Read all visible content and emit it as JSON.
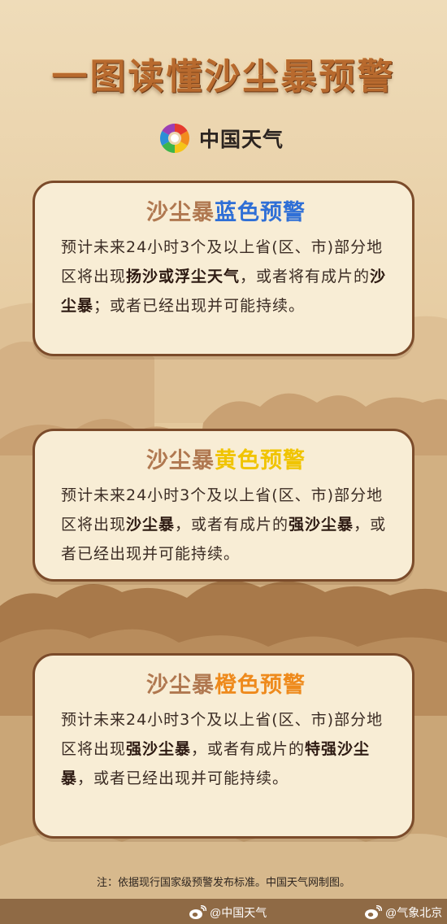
{
  "title": "一图读懂沙尘暴预警",
  "brand": {
    "name": "中国天气",
    "logo_icon": "china-weather-logo-icon"
  },
  "watermark_text": "中国天气",
  "cards": [
    {
      "title_prefix": "沙尘暴",
      "title_level": "蓝色预警",
      "level_color": "#2f6fd6",
      "segments": [
        {
          "text": "预计未来24小时3个及以上省(区、市)部分地区将出现",
          "bold": false
        },
        {
          "text": "扬沙或浮尘天气",
          "bold": true
        },
        {
          "text": "，或者将有成片的",
          "bold": false
        },
        {
          "text": "沙尘暴",
          "bold": true
        },
        {
          "text": "；或者已经出现并可能持续。",
          "bold": false
        }
      ]
    },
    {
      "title_prefix": "沙尘暴",
      "title_level": "黄色预警",
      "level_color": "#f0c400",
      "segments": [
        {
          "text": "预计未来24小时3个及以上省(区、市)部分地区将出现",
          "bold": false
        },
        {
          "text": "沙尘暴",
          "bold": true
        },
        {
          "text": "，或者有成片的",
          "bold": false
        },
        {
          "text": "强沙尘暴",
          "bold": true
        },
        {
          "text": "，或者已经出现并可能持续。",
          "bold": false
        }
      ]
    },
    {
      "title_prefix": "沙尘暴",
      "title_level": "橙色预警",
      "level_color": "#ee8a1c",
      "segments": [
        {
          "text": "预计未来24小时3个及以上省(区、市)部分地区将出现",
          "bold": false
        },
        {
          "text": "强沙尘暴",
          "bold": true
        },
        {
          "text": "，或者有成片的",
          "bold": false
        },
        {
          "text": "特强沙尘暴",
          "bold": true
        },
        {
          "text": "，或者已经出现并可能持续。",
          "bold": false
        }
      ]
    }
  ],
  "note": "注：依据现行国家级预警发布标准。中国天气网制图。",
  "footer": {
    "left": "@中国天气",
    "right": "@气象北京",
    "icon": "weibo-icon"
  }
}
